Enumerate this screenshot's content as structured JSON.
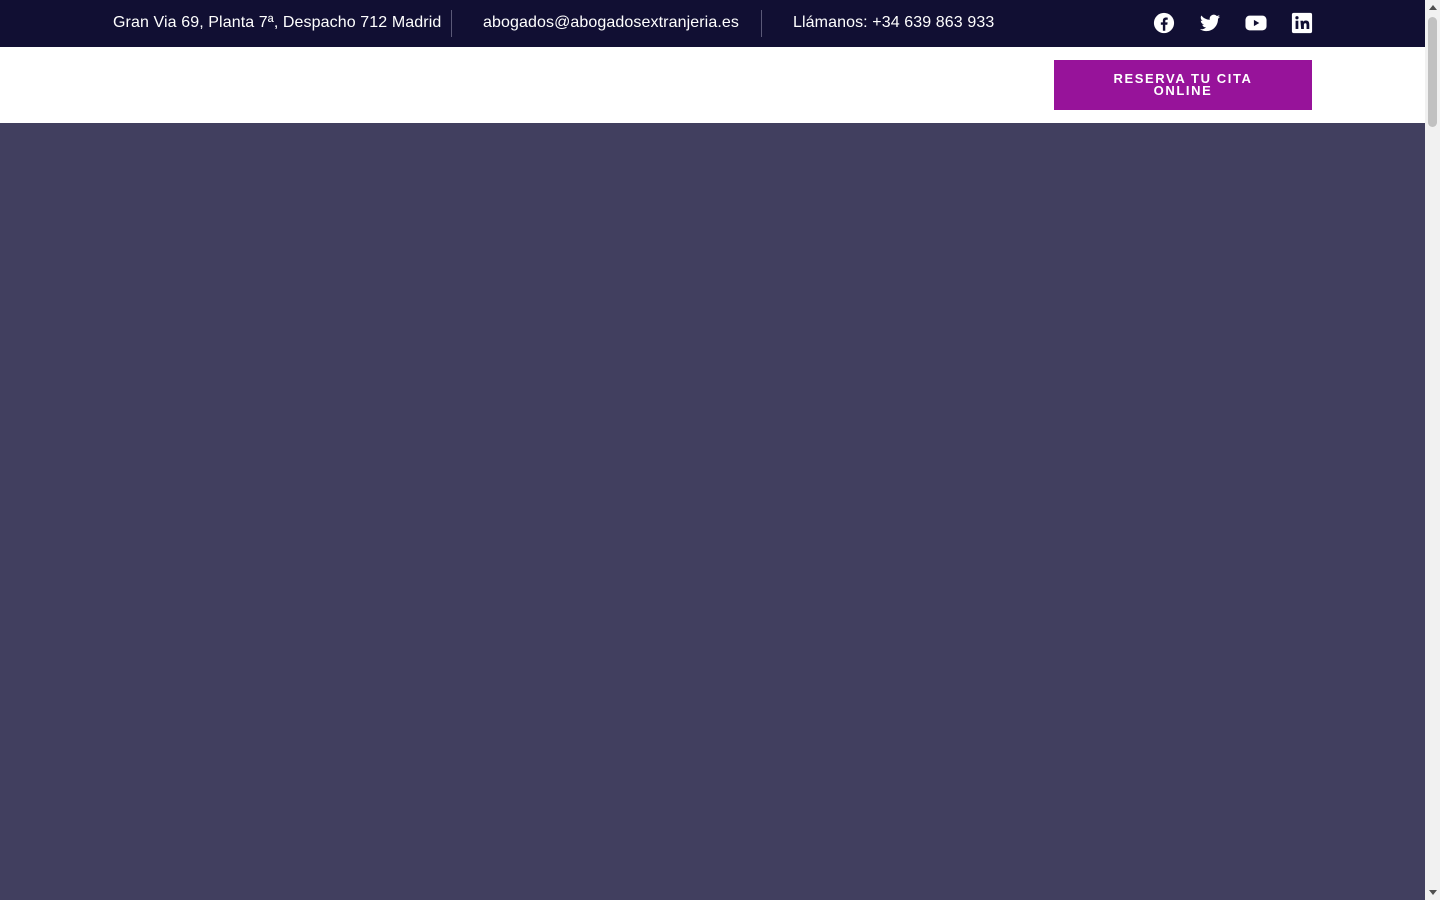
{
  "topbar": {
    "address": "Gran Via 69, Planta 7ª, Despacho 712 Madrid",
    "email": "abogados@abogadosextranjeria.es",
    "phone": "Llámanos: +34 639 863 933",
    "socials": [
      {
        "name": "facebook-icon"
      },
      {
        "name": "twitter-icon"
      },
      {
        "name": "youtube-icon"
      },
      {
        "name": "linkedin-icon"
      }
    ]
  },
  "header": {
    "cta_label": "RESERVA TU CITA ONLINE"
  },
  "colors": {
    "topbar_bg": "#110f33",
    "cta_bg": "#97139a",
    "hero_bg": "#413f5f"
  }
}
